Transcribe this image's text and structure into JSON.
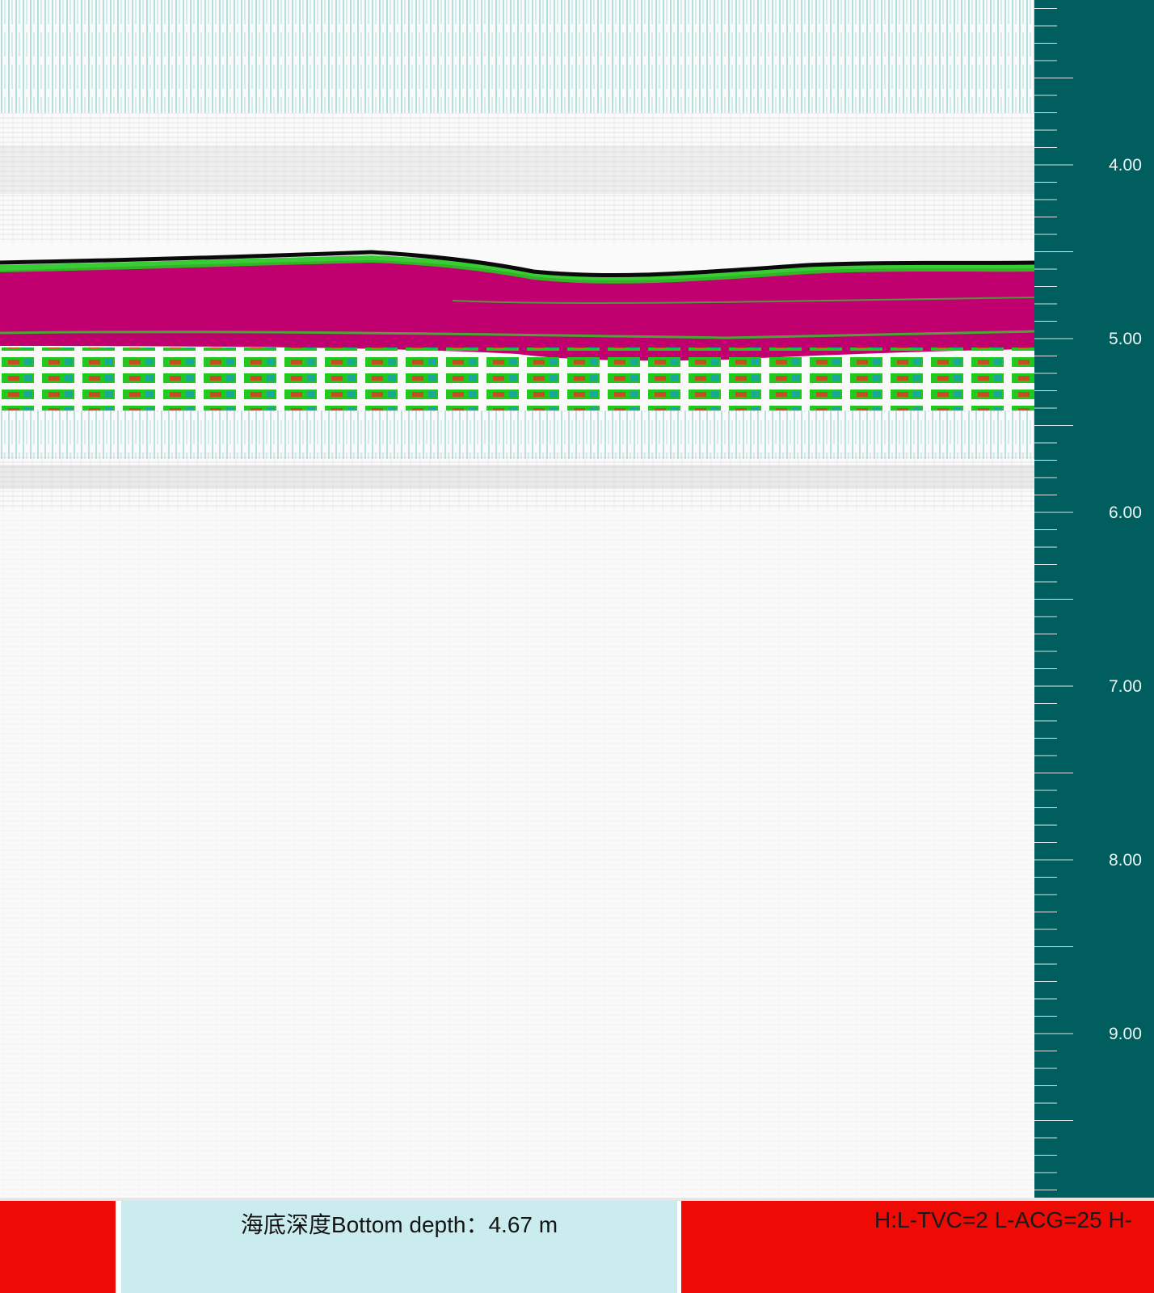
{
  "echogram": {
    "colors": {
      "background": "#fafafa",
      "bottom_echo": "#c0006e",
      "strong": "#00c800",
      "medium": "#1aa5a2",
      "weak": "#b0b0b0",
      "trace_line": "#0a0a0a",
      "hot_spot": "#ff2020"
    }
  },
  "depth_scale": {
    "background": "#005f5e",
    "unit": "m",
    "labels": [
      "4.00",
      "5.00",
      "6.00",
      "7.00",
      "8.00",
      "9.00"
    ],
    "major_values": [
      4,
      5,
      6,
      7,
      8,
      9
    ],
    "range": [
      3.06,
      10.0
    ],
    "minor_step": 0.1
  },
  "status_bar": {
    "depth_label": "海底深度Bottom depth：4.67 m",
    "params": "H:L-TVC=2 L-ACG=25 H-"
  }
}
